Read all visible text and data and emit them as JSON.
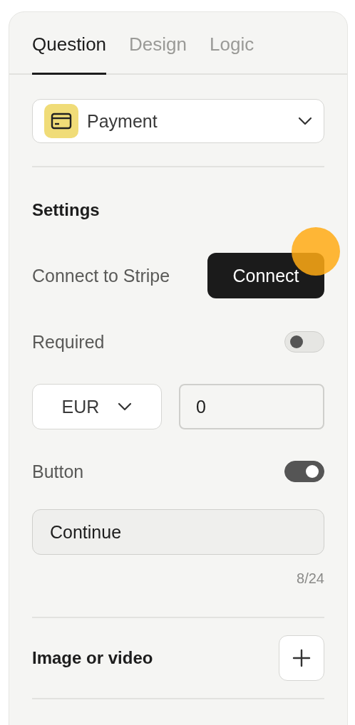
{
  "tabs": [
    {
      "label": "Question",
      "selected": true
    },
    {
      "label": "Design",
      "selected": false
    },
    {
      "label": "Logic",
      "selected": false
    }
  ],
  "question_type": {
    "label": "Payment"
  },
  "settings": {
    "title": "Settings",
    "stripe": {
      "label": "Connect to Stripe",
      "button": "Connect"
    },
    "required": {
      "label": "Required",
      "on": false
    },
    "currency": {
      "value": "EUR"
    },
    "amount": {
      "value": "0"
    },
    "button": {
      "label": "Button",
      "on": true
    },
    "button_text": {
      "value": "Continue",
      "counter": "8/24"
    }
  },
  "media": {
    "label": "Image or video"
  }
}
